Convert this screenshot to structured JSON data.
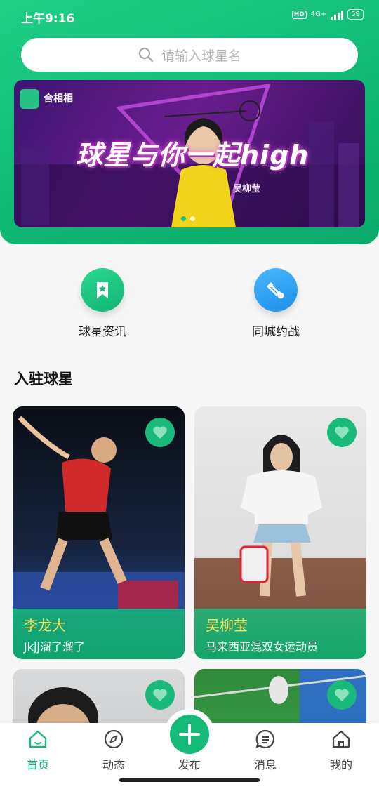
{
  "status_bar": {
    "time": "上午9:16",
    "hd": "HD",
    "network": "4G+",
    "battery": "59"
  },
  "search": {
    "placeholder": "请输入球星名",
    "icon": "search-icon"
  },
  "banner": {
    "logo_text": "合相相",
    "title": "球星与你一起high",
    "player_name": "吴柳莹",
    "page_count": 2,
    "active_index": 0
  },
  "quick_entries": [
    {
      "label": "球星资讯",
      "icon": "bookmark-star-icon",
      "color": "#1bc883"
    },
    {
      "label": "同城约战",
      "icon": "shuttlecock-icon",
      "color": "#2a9ef0"
    }
  ],
  "section": {
    "title": "入驻球星"
  },
  "players": [
    {
      "name": "李龙大",
      "desc": "Jkjj溜了溜了"
    },
    {
      "name": "吴柳莹",
      "desc": "马来西亚混双女运动员"
    }
  ],
  "nav": {
    "items": [
      {
        "label": "首页",
        "icon": "home-icon",
        "active": true
      },
      {
        "label": "动态",
        "icon": "compass-icon",
        "active": false
      },
      {
        "label": "发布",
        "icon": "plus-icon",
        "active": false
      },
      {
        "label": "消息",
        "icon": "message-icon",
        "active": false
      },
      {
        "label": "我的",
        "icon": "profile-home-icon",
        "active": false
      }
    ]
  },
  "colors": {
    "primary": "#15b978",
    "heading": "#111111",
    "caption_name": "#f5e75b"
  }
}
